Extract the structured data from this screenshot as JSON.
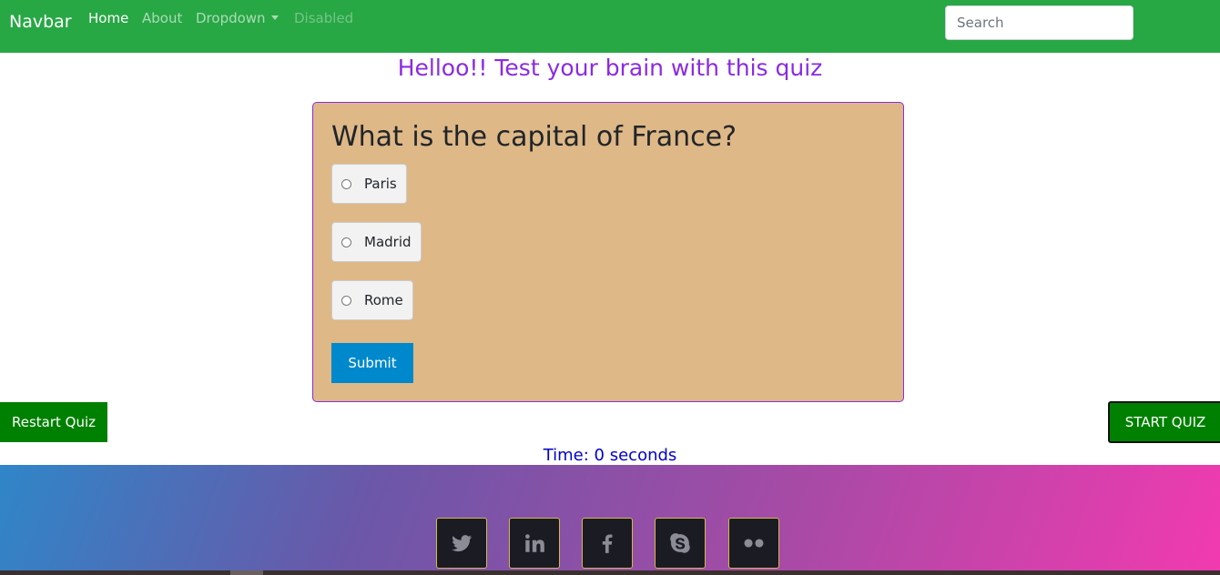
{
  "navbar": {
    "brand": "Navbar",
    "links": [
      {
        "label": "Home"
      },
      {
        "label": "About"
      },
      {
        "label": "Dropdown"
      },
      {
        "label": "Disabled"
      }
    ],
    "search_placeholder": "Search",
    "background_color": "#28a745"
  },
  "page": {
    "title": "Helloo!! Test your brain with this quiz",
    "title_color": "#8a2be2"
  },
  "quiz": {
    "question": "What is the capital of France?",
    "options": [
      {
        "label": "Paris"
      },
      {
        "label": "Madrid"
      },
      {
        "label": "Rome"
      }
    ],
    "submit_label": "Submit",
    "card_color": "#deb887"
  },
  "controls": {
    "restart_label": "Restart Quiz",
    "start_label": "START QUIZ"
  },
  "timer": {
    "text": "Time: 0 seconds"
  },
  "footer": {
    "social_icons": [
      "twitter-icon",
      "linkedin-icon",
      "facebook-icon",
      "skype-icon",
      "flickr-icon"
    ]
  }
}
